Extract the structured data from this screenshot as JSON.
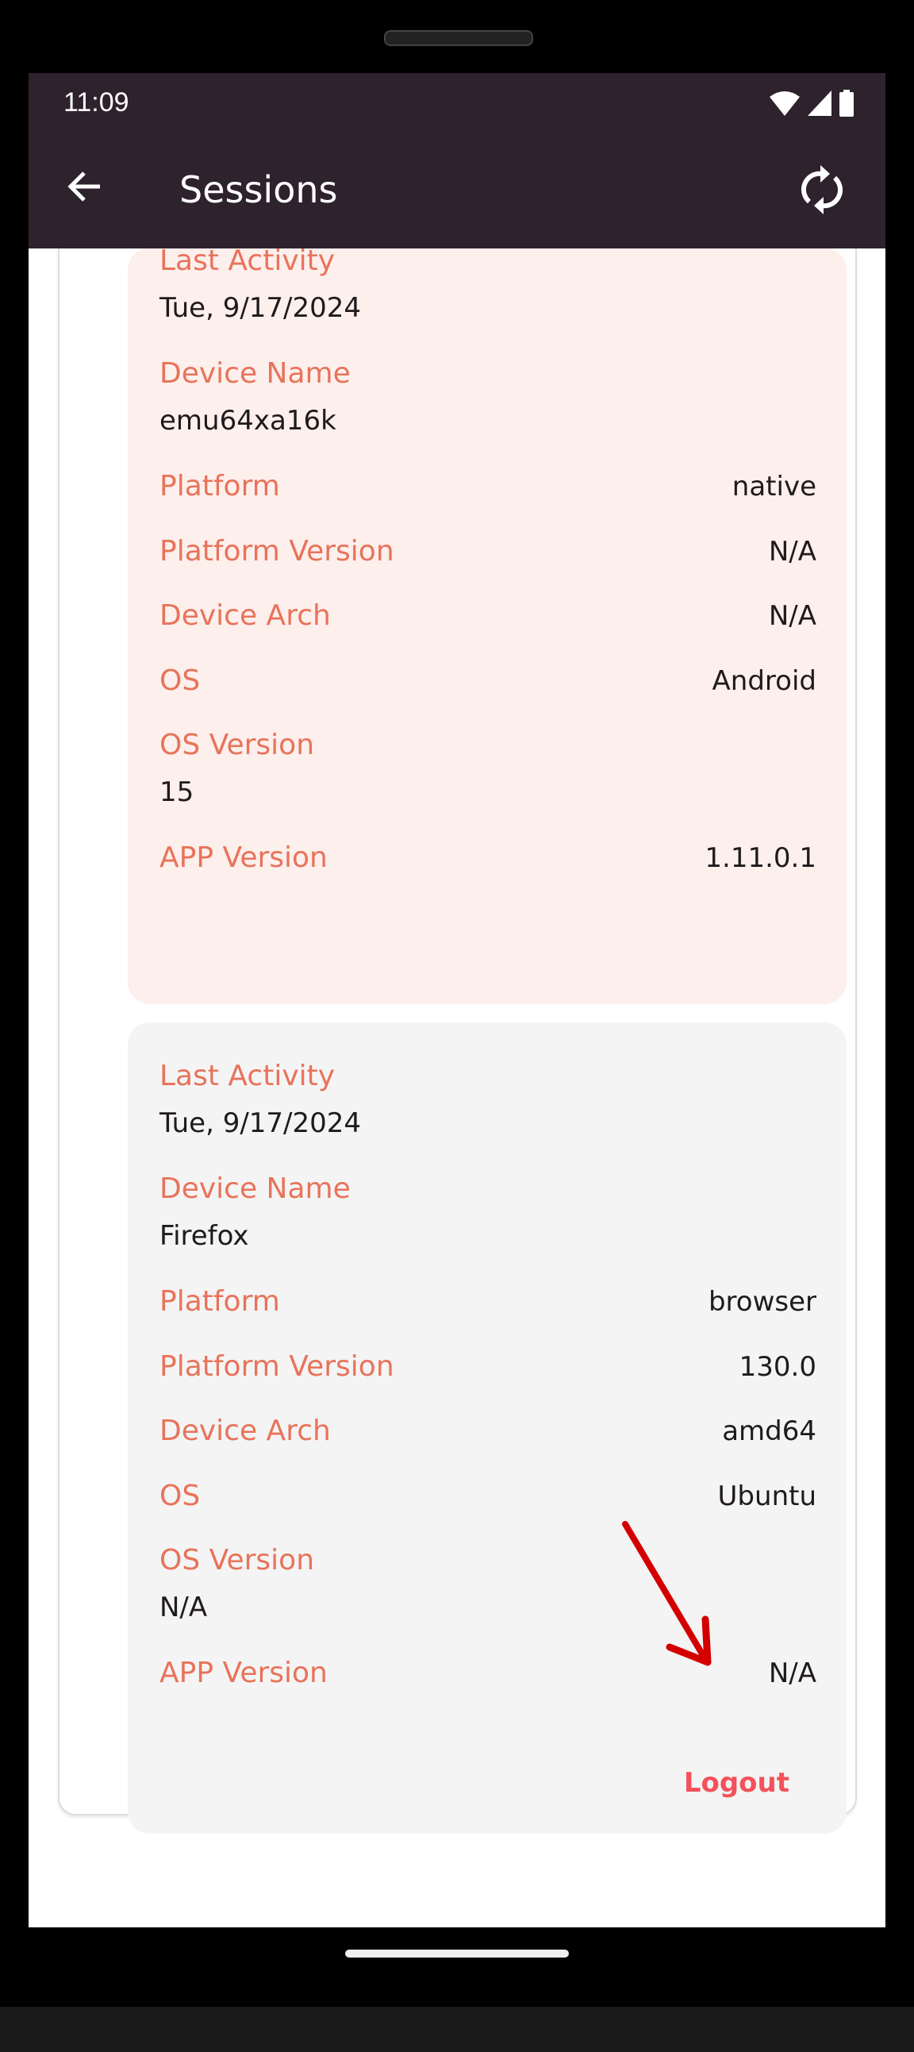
{
  "status_bar": {
    "time": "11:09",
    "icons": [
      "wifi-icon",
      "signal-icon",
      "battery-icon"
    ]
  },
  "app_bar": {
    "title": "Sessions",
    "back_icon": "arrow-back-icon",
    "refresh_icon": "refresh-icon"
  },
  "colors": {
    "app_bar": "#2e222d",
    "label": "#e8735a",
    "current_session_bg": "#fdefec",
    "session_bg": "#f4f4f4",
    "logout": "#f4515a",
    "annotation_arrow": "#d40000"
  },
  "sessions": [
    {
      "fields": [
        {
          "label": "Last Activity",
          "value": "Tue, 9/17/2024",
          "stacked": true
        },
        {
          "label": "Device Name",
          "value": "emu64xa16k",
          "stacked": true
        },
        {
          "label": "Platform",
          "value": "native"
        },
        {
          "label": "Platform Version",
          "value": "N/A"
        },
        {
          "label": "Device Arch",
          "value": "N/A"
        },
        {
          "label": "OS",
          "value": "Android"
        },
        {
          "label": "OS Version",
          "value": "15",
          "stacked": true
        },
        {
          "label": "APP Version",
          "value": "1.11.0.1"
        }
      ]
    },
    {
      "fields": [
        {
          "label": "Last Activity",
          "value": "Tue, 9/17/2024",
          "stacked": true
        },
        {
          "label": "Device Name",
          "value": "Firefox",
          "stacked": true
        },
        {
          "label": "Platform",
          "value": "browser"
        },
        {
          "label": "Platform Version",
          "value": "130.0"
        },
        {
          "label": "Device Arch",
          "value": "amd64"
        },
        {
          "label": "OS",
          "value": "Ubuntu"
        },
        {
          "label": "OS Version",
          "value": "N/A",
          "stacked": true
        },
        {
          "label": "APP Version",
          "value": "N/A"
        }
      ],
      "logout_label": "Logout"
    }
  ]
}
